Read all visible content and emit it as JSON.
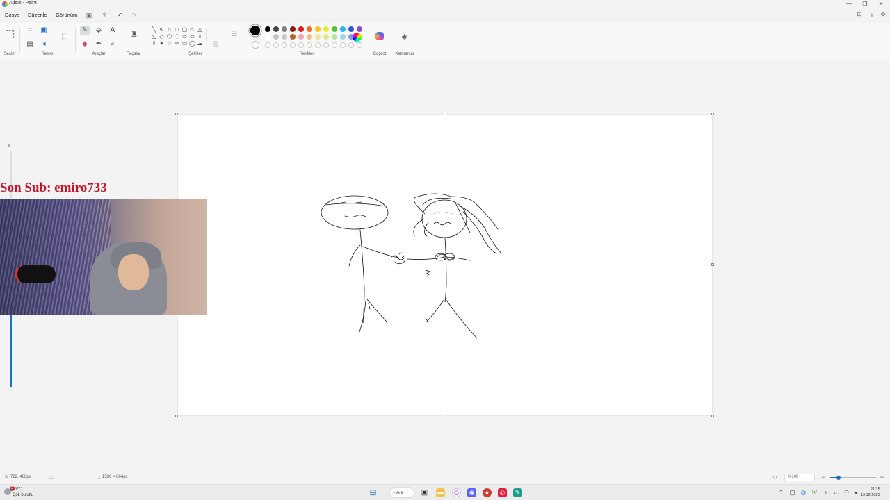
{
  "window": {
    "title": "Adsız - Paint",
    "minimize_glyph": "—",
    "maximize_glyph": "❐",
    "close_glyph": "✕"
  },
  "menu": {
    "items": [
      "Dosya",
      "Düzenle",
      "Görünüm"
    ]
  },
  "ribbon": {
    "groups": {
      "selection": "Seçim",
      "image": "Resim",
      "tools": "Araçlar",
      "brushes": "Fırçalar",
      "shapes": "Şekiller",
      "colors": "Renkler",
      "copilot": "Copilot",
      "layers": "Katmanlar"
    }
  },
  "colors": {
    "accent": "#1c6fc8",
    "active_color": "#000000",
    "palette_row1": [
      "#000000",
      "#444444",
      "#7f7f7f",
      "#8b1a1a",
      "#e31b1b",
      "#f26a1b",
      "#f7c51b",
      "#ecee2a",
      "#53c33a",
      "#2bb5e8",
      "#2e57d3",
      "#8b4cc7"
    ],
    "palette_row2": [
      "#ffffff",
      "#c3c3c3",
      "#c9c9c9",
      "#b5651d",
      "#f5a3b1",
      "#f5c07a",
      "#f2e3a1",
      "#d7f07c",
      "#b4e6a5",
      "#9ed9ea",
      "#7e9fd3",
      "#b99fdc"
    ]
  },
  "overlay": {
    "last_sub": "Son Sub: emiro733"
  },
  "status": {
    "cursor_pos": "722, 468px",
    "canvas_size": "1536 × 864px",
    "zoom": "%100"
  },
  "taskbar": {
    "temperature": "13°C",
    "weather": "Çok bulutlu",
    "notification_count": "3",
    "search_label": "Ara",
    "time": "21:35",
    "date": "19.12.2025"
  }
}
